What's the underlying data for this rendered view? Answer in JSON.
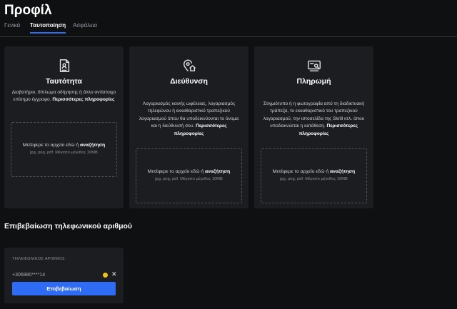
{
  "page": {
    "title": "Προφίλ"
  },
  "tabs": [
    {
      "label": "Γενικά",
      "active": false
    },
    {
      "label": "Ταυτοποίηση",
      "active": true
    },
    {
      "label": "Ασφάλεια",
      "active": false
    }
  ],
  "cards": [
    {
      "icon": "id-document-icon",
      "title": "Ταυτότητα",
      "description": "Διαβατήριο, δίπλωμα οδήγησης ή άλλο αντίστοιχο επίσημο έγγραφο.",
      "more_link": "Περισσότερες πληροφορίες",
      "dropzone_text": "Μετέφερε το αρχείο εδώ ή",
      "dropzone_browse": "αναζήτηση",
      "dropzone_hint": "jpg, png, pdf. Μέγιστο μέγεθος 10MB"
    },
    {
      "icon": "address-pin-home-icon",
      "title": "Διεύθυνση",
      "description": "Λογαριασμός κοινής ωφέλειας, λογαριασμός τηλεφώνου ή εκκαθαριστικό τραπεζικού λογαριασμού όπου θα υποδεικνύονται το όνομα και η διεύθυνσή σου.",
      "more_link": "Περισσότερες πληροφορίες",
      "dropzone_text": "Μετέφερε το αρχείο εδώ ή",
      "dropzone_browse": "αναζήτηση",
      "dropzone_hint": "jpg, png, pdf. Μέγιστο μέγεθος 10MB"
    },
    {
      "icon": "payment-card-search-icon",
      "title": "Πληρωμή",
      "description": "Στιγμιότυπο ή η φωτογραφία από τη διαδικτυακή τράπεζα, το εκκαθαριστικό του τραπεζικού λογαριασμού, την ιστοσελίδα της Skrill κτλ. όπου υποδεικνύεται η κατάθεση.",
      "more_link": "Περισσότερες πληροφορίες",
      "dropzone_text": "Μετέφερε το αρχείο εδώ ή",
      "dropzone_browse": "αναζήτηση",
      "dropzone_hint": "jpg, png, pdf. Μέγιστο μέγεθος 10MB"
    }
  ],
  "phone_verification": {
    "section_title": "Επιβεβαίωση τηλεφωνικού αριθμού",
    "field_label": "ΤΗΛΕΦΩΝΙΚΟΣ ΑΡΙΘΜΟΣ",
    "phone_value": "+306980****14",
    "status_color": "#f2c21b",
    "clear_symbol": "✕",
    "verify_label": "Επιβεβαίωση"
  },
  "colors": {
    "accent": "#2f6cf5",
    "background": "#0f1012",
    "card": "#1c1d21"
  }
}
